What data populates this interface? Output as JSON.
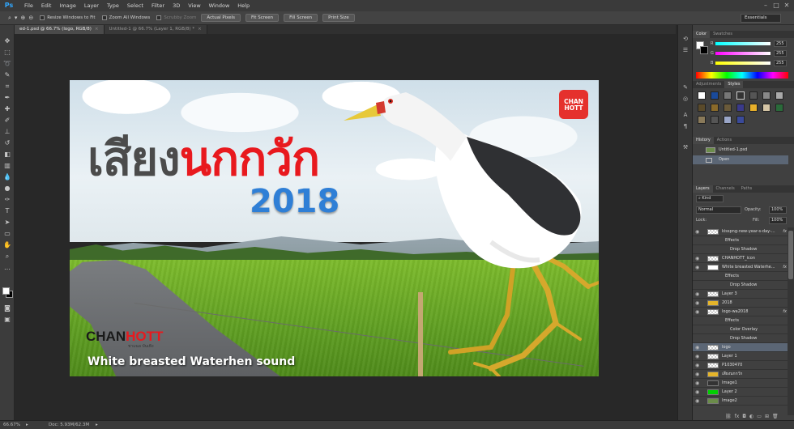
{
  "app": {
    "logo": "Ps"
  },
  "menu": [
    "File",
    "Edit",
    "Image",
    "Layer",
    "Type",
    "Select",
    "Filter",
    "3D",
    "View",
    "Window",
    "Help"
  ],
  "options": {
    "resize_windows": "Resize Windows to Fit",
    "zoom_all": "Zoom All Windows",
    "scrubby": "Scrubby Zoom",
    "actual_pixels": "Actual Pixels",
    "fit_screen": "Fit Screen",
    "fill_screen": "Fill Screen",
    "print_size": "Print Size",
    "workspace": "Essentials"
  },
  "tabs": [
    {
      "label": "ed-1.psd @ 66.7% (logo, RGB/8)"
    },
    {
      "label": "Untitled-1 @ 66.7% (Layer 1, RGB/8) *"
    }
  ],
  "artwork": {
    "title_part1": "เสียง",
    "title_part2": "นกกวัก",
    "year": "2018",
    "badge_line1": "CHAN",
    "badge_line2": "HOTT",
    "brand_part1": "CHAN",
    "brand_part2": "HOTT",
    "brand_sub": "ชาแนล บันเทิง",
    "caption": "White breasted Waterhen sound"
  },
  "status": {
    "zoom": "66.67%",
    "doc": "Doc: 5.93M/62.3M"
  },
  "color_panel": {
    "tabs": [
      "Color",
      "Swatches"
    ],
    "sliders": [
      {
        "label": "R",
        "value": "255",
        "color": "#ff0000"
      },
      {
        "label": "G",
        "value": "255",
        "color": "#00ff00"
      },
      {
        "label": "B",
        "value": "255",
        "color": "#0000ff"
      }
    ]
  },
  "styles_panel": {
    "tabs": [
      "Adjustments",
      "Styles"
    ]
  },
  "history_panel": {
    "tabs": [
      "History",
      "Actions"
    ],
    "items": [
      {
        "label": "Untitled-1.psd",
        "selected": false
      },
      {
        "label": "Open",
        "selected": true
      }
    ]
  },
  "layers_panel": {
    "tabs": [
      "Layers",
      "Channels",
      "Paths"
    ],
    "kind": "Kind",
    "blend": "Normal",
    "opacity_label": "Opacity:",
    "opacity": "100%",
    "lock_label": "Lock:",
    "fill_label": "Fill:",
    "fill": "100%",
    "layers": [
      {
        "name": "kisspng-new-year-s-day-...",
        "fx": "fx",
        "type": "layer"
      },
      {
        "name": "Effects",
        "type": "sub"
      },
      {
        "name": "Drop Shadow",
        "type": "sub2"
      },
      {
        "name": "CHANHOTT_icon",
        "type": "layer"
      },
      {
        "name": "White breasted Waterhe...",
        "fx": "fx",
        "type": "layer"
      },
      {
        "name": "Effects",
        "type": "sub"
      },
      {
        "name": "Drop Shadow",
        "type": "sub2"
      },
      {
        "name": "Layer 3",
        "type": "layer"
      },
      {
        "name": "2018",
        "type": "layer"
      },
      {
        "name": "logo-wa2018",
        "fx": "fx",
        "type": "layer"
      },
      {
        "name": "Effects",
        "type": "sub"
      },
      {
        "name": "Color Overlay",
        "type": "sub2"
      },
      {
        "name": "Drop Shadow",
        "type": "sub2"
      },
      {
        "name": "logo",
        "type": "layer",
        "selected": true
      },
      {
        "name": "Layer 1",
        "type": "layer"
      },
      {
        "name": "P1030470",
        "type": "layer"
      },
      {
        "name": "เสียงนกกวัก",
        "type": "layer"
      },
      {
        "name": "Image1",
        "type": "layer"
      },
      {
        "name": "Layer 2",
        "type": "layer"
      },
      {
        "name": "Image2",
        "type": "layer"
      }
    ]
  }
}
